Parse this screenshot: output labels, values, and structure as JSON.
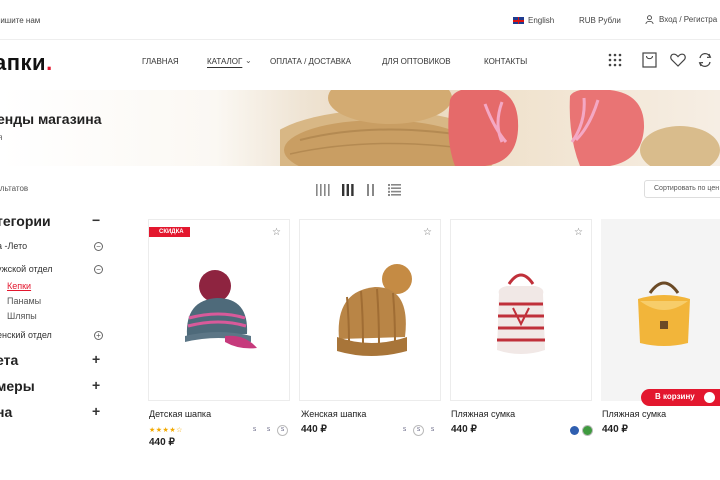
{
  "topbar": {
    "contact": "пишите нам",
    "language": "English",
    "currency": "RUB Рубли",
    "login": "Вход / Регистра"
  },
  "header": {
    "logo_text": "апки",
    "logo_dot": ".",
    "nav": [
      "ГЛАВНАЯ",
      "КАТАЛОГ",
      "ОПЛАТА / ДОСТАВКА",
      "ДЛЯ ОПТОВИКОВ",
      "КОНТАКТЫ"
    ],
    "nav_active_index": 1,
    "nav_caret": "⌄",
    "icons": [
      "grid-icon",
      "cart-icon",
      "heart-icon",
      "refresh-icon"
    ]
  },
  "banner": {
    "title": "енды магазина",
    "breadcrumb": "я"
  },
  "toolbar": {
    "results": "ультатов",
    "sort": "Сортировать по цен"
  },
  "sidebar": {
    "categories_title": "тегории",
    "categories_sign": "−",
    "items": [
      {
        "label": "а -Лето",
        "sign": "−"
      },
      {
        "label": "ужской отдел",
        "sign": "−"
      },
      {
        "label": "Кепки",
        "active": true
      },
      {
        "label": "Панамы"
      },
      {
        "label": "Шляпы"
      },
      {
        "label": "енский отдел",
        "sign": "+"
      }
    ],
    "filters": [
      {
        "label": "ета",
        "sign": "+"
      },
      {
        "label": "меры",
        "sign": "+"
      },
      {
        "label": "на",
        "sign": "+"
      }
    ]
  },
  "products": [
    {
      "name": "Детская шапка",
      "price": "440 ₽",
      "badge": "скидка",
      "rating": "★★★★☆",
      "rating_value": 4,
      "swatches": [
        "S",
        "S",
        "S"
      ],
      "favorite": "☆"
    },
    {
      "name": "Женская шапка",
      "price": "440 ₽",
      "swatches": [
        "S",
        "S",
        "S"
      ],
      "favorite": "☆"
    },
    {
      "name": "Пляжная сумка",
      "price": "440 ₽",
      "swatches": [],
      "favorite": "☆"
    },
    {
      "name": "Пляжная сумка",
      "price": "440 ₽",
      "swatches": [],
      "cart_button": "В корзину"
    }
  ],
  "colors": {
    "accent": "#e3172e"
  }
}
